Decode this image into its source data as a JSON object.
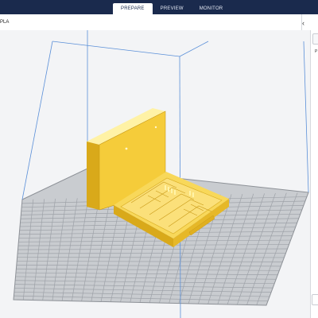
{
  "header": {
    "tabs": [
      {
        "label": "PREPARE",
        "active": true
      },
      {
        "label": "PREVIEW",
        "active": false
      },
      {
        "label": "MONITOR",
        "active": false
      }
    ]
  },
  "toolbar": {
    "project_name": "PLA",
    "collapse_icon": "chevron-left-icon"
  },
  "side_panel": {
    "label": "P"
  },
  "colors": {
    "header_bg": "#1a2a4d",
    "model_yellow": "#f5cc3a",
    "grid_line": "#9ea2a8",
    "build_volume_edge": "#5a8fd8"
  }
}
